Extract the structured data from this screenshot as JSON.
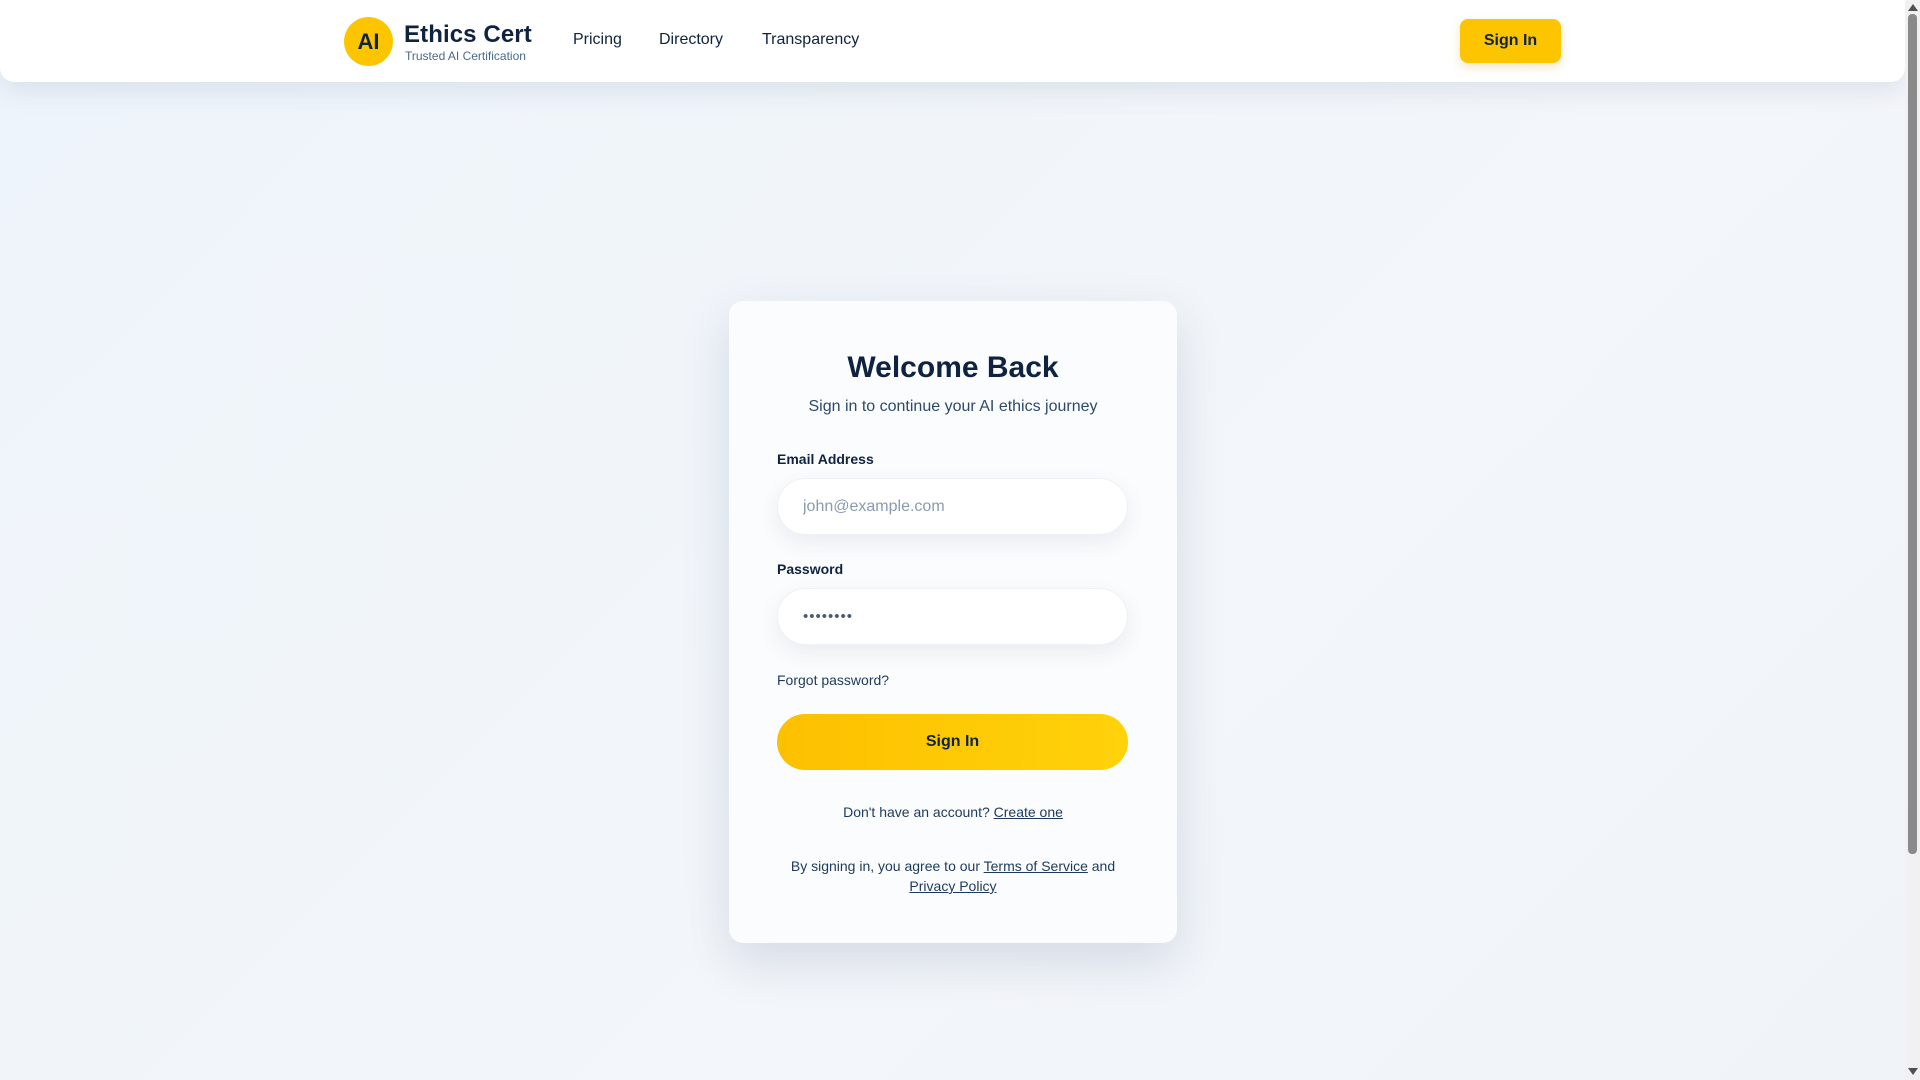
{
  "header": {
    "logo_text": "AI",
    "brand_name": "Ethics Cert",
    "brand_tagline": "Trusted AI Certification",
    "nav": {
      "pricing": "Pricing",
      "directory": "Directory",
      "transparency": "Transparency"
    },
    "signin_label": "Sign In"
  },
  "login": {
    "title": "Welcome Back",
    "subtitle": "Sign in to continue your AI ethics journey",
    "email_label": "Email Address",
    "email_placeholder": "john@example.com",
    "email_value": "",
    "password_label": "Password",
    "password_value": "••••••••",
    "forgot_label": "Forgot password?",
    "submit_label": "Sign In",
    "signup_prompt": "Don't have an account?",
    "signup_link": "Create one",
    "legal_prefix": "By signing in, you agree to our",
    "terms_link": "Terms of Service",
    "legal_and": "and",
    "privacy_link": "Privacy Policy"
  },
  "colors": {
    "accent": "#fdc500",
    "text_primary": "#0f2340",
    "background": "#eef4fb"
  },
  "icons": {
    "scroll_up": "triangle-up-icon",
    "scroll_down": "triangle-down-icon"
  }
}
